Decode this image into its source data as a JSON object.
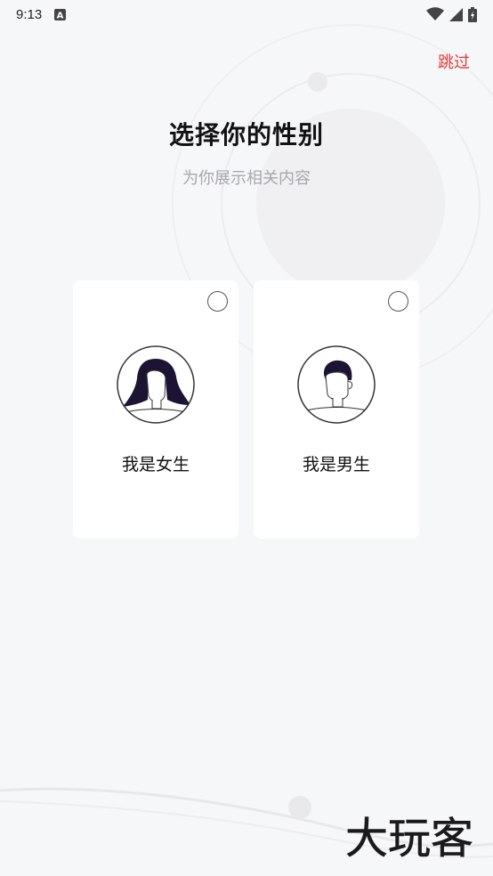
{
  "status_bar": {
    "time": "9:13",
    "icons": [
      "a-notification-icon",
      "wifi-icon",
      "signal-icon",
      "battery-icon"
    ]
  },
  "header": {
    "skip_label": "跳过",
    "title": "选择你的性别",
    "subtitle": "为你展示相关内容"
  },
  "options": [
    {
      "id": "female",
      "label": "我是女生",
      "selected": false,
      "avatar": "female-avatar-icon"
    },
    {
      "id": "male",
      "label": "我是男生",
      "selected": false,
      "avatar": "male-avatar-icon"
    }
  ],
  "watermark": {
    "text": "大玩客"
  },
  "colors": {
    "background": "#f6f7f9",
    "accent": "#e53935",
    "card": "#ffffff",
    "subtitle": "#a7a7ad"
  }
}
